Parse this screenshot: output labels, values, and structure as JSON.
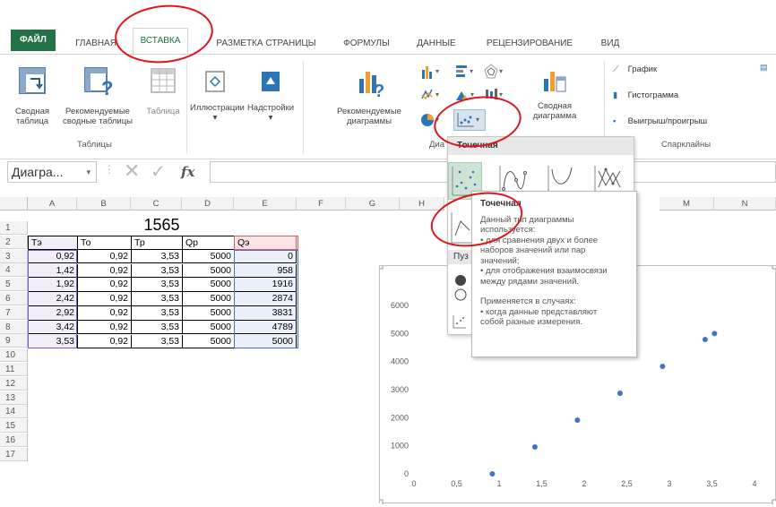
{
  "tabs": {
    "file": "ФАЙЛ",
    "home": "ГЛАВНАЯ",
    "insert": "ВСТАВКА",
    "page_layout": "РАЗМЕТКА СТРАНИЦЫ",
    "formulas": "ФОРМУЛЫ",
    "data": "ДАННЫЕ",
    "review": "РЕЦЕНЗИРОВАНИЕ",
    "view": "ВИД"
  },
  "ribbon": {
    "pivot_table": [
      "Сводная",
      "таблица"
    ],
    "recommended_pivot": [
      "Рекомендуемые",
      "сводные таблицы"
    ],
    "table": "Таблица",
    "group_tables": "Таблицы",
    "illustrations": "Иллюстрации",
    "addins": "Надстройки",
    "recommended_charts": [
      "Рекомендуемые",
      "диаграммы"
    ],
    "pivot_chart": [
      "Сводная",
      "диаграмма"
    ],
    "group_charts_partial": "Диа",
    "sparkline_line": "График",
    "sparkline_column": "Гистограмма",
    "sparkline_winloss": "Выигрыш/проигрыш",
    "group_sparklines": "Спарклайны"
  },
  "formula_bar": {
    "name_box": "Диагра...",
    "fx": "fx",
    "formula": ""
  },
  "columns": [
    "A",
    "B",
    "C",
    "D",
    "E",
    "F",
    "G",
    "H",
    "",
    "",
    "",
    "",
    "M",
    "N"
  ],
  "rows": [
    "1",
    "2",
    "3",
    "4",
    "5",
    "6",
    "7",
    "8",
    "9",
    "10",
    "11",
    "12",
    "13",
    "14",
    "15",
    "16",
    "17"
  ],
  "sheet": {
    "title": "1565",
    "headers": [
      "Тэ",
      "То",
      "Тр",
      "Qр",
      "Qэ"
    ],
    "data": [
      [
        "0,92",
        "0,92",
        "3,53",
        "5000",
        "0"
      ],
      [
        "1,42",
        "0,92",
        "3,53",
        "5000",
        "958"
      ],
      [
        "1,92",
        "0,92",
        "3,53",
        "5000",
        "1916"
      ],
      [
        "2,42",
        "0,92",
        "3,53",
        "5000",
        "2874"
      ],
      [
        "2,92",
        "0,92",
        "3,53",
        "5000",
        "3831"
      ],
      [
        "3,42",
        "0,92",
        "3,53",
        "5000",
        "4789"
      ],
      [
        "3,53",
        "0,92",
        "3,53",
        "5000",
        "5000"
      ]
    ]
  },
  "dropdown": {
    "header": "Точечная",
    "section2": "Пуз"
  },
  "tooltip": {
    "title": "Точечная",
    "lines": [
      "Данный тип диаграммы",
      "используется:",
      "• для сравнения двух и более",
      "наборов значений или пар",
      "значений;",
      "• для отображения взаимосвязи",
      "между рядами значений.",
      "",
      "Применяется в случаях:",
      "• когда данные представляют",
      "собой разные измерения."
    ]
  },
  "chart_data": {
    "type": "scatter",
    "x": [
      0.92,
      1.42,
      1.92,
      2.42,
      2.92,
      3.42,
      3.53
    ],
    "y": [
      0,
      958,
      1916,
      2874,
      3831,
      4789,
      5000
    ],
    "xlim": [
      0,
      4
    ],
    "ylim": [
      0,
      6000
    ],
    "xticks": [
      "0",
      "0,5",
      "1",
      "1,5",
      "2",
      "2,5",
      "3",
      "3,5",
      "4"
    ],
    "yticks": [
      "0",
      "1000",
      "2000",
      "3000",
      "4000",
      "5000",
      "6000"
    ],
    "marker_color": "#4472c4",
    "grid": false
  },
  "colors": {
    "excel_green": "#217346",
    "highlight_red": "#e0141c",
    "range_purple": "#7e58c2",
    "range_blue": "#4472c4",
    "range_red": "#e05b5b"
  }
}
